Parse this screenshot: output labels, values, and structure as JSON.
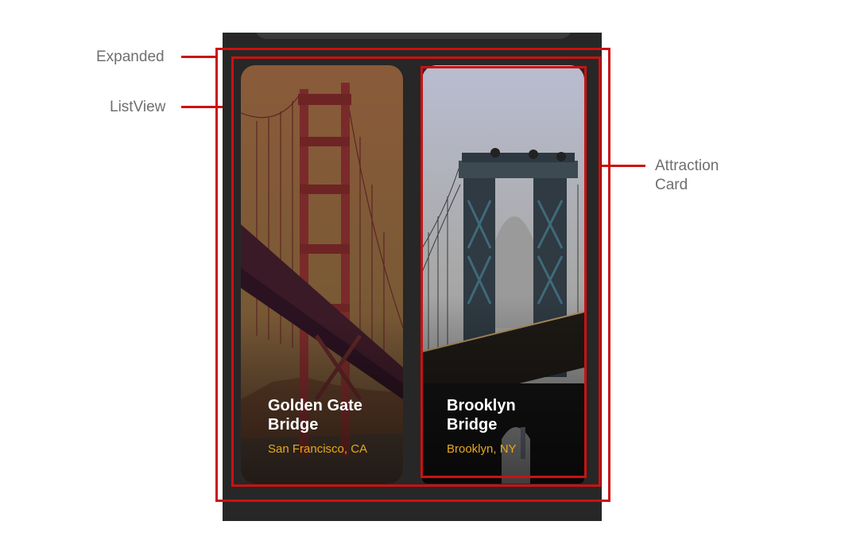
{
  "callouts": {
    "expanded": "Expanded",
    "listview": "ListView",
    "attraction_card_line1": "Attraction",
    "attraction_card_line2": "Card"
  },
  "cards": [
    {
      "title_line1": "Golden Gate",
      "title_line2": "Bridge",
      "subtitle": "San Francisco, CA"
    },
    {
      "title_line1": "Brooklyn",
      "title_line2": "Bridge",
      "subtitle": "Brooklyn, NY"
    }
  ],
  "colors": {
    "annotation_red": "#cc1111",
    "subtitle_gold": "#e8a91e",
    "phone_bg": "#272727",
    "callout_gray": "#6f6f6f"
  }
}
